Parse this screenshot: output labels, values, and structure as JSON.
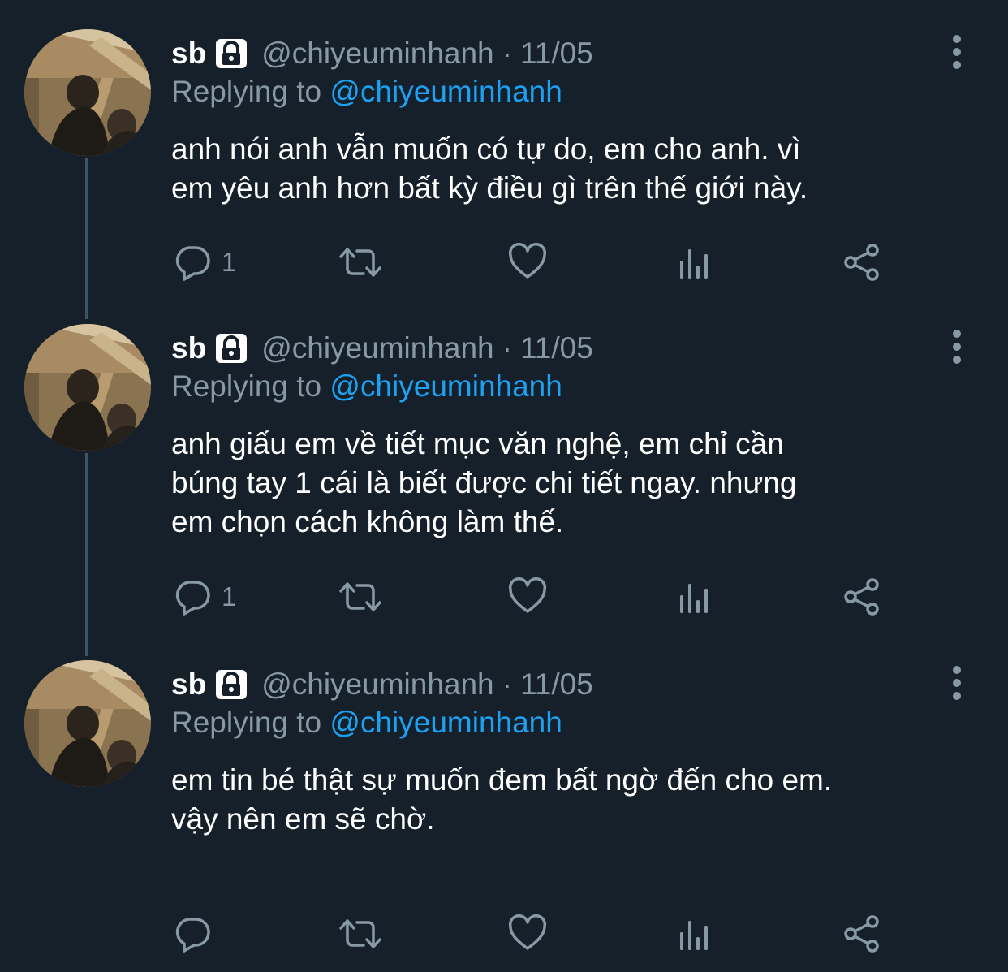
{
  "colors": {
    "background": "#15202b",
    "text_primary": "#ffffff",
    "text_secondary": "#8899a6",
    "accent": "#1da1f2",
    "thread_line": "#3d5466"
  },
  "tweets": [
    {
      "name": "sb",
      "handle": "@chiyeuminhanh",
      "separator": "·",
      "date": "11/05",
      "replying_prefix": "Replying to",
      "replying_handle": "@chiyeuminhanh",
      "lines": [
        "anh nói anh vẫn muốn có tự do, em cho anh. vì",
        "em yêu anh hơn bất kỳ điều gì trên thế giới này."
      ],
      "reply_count": "1"
    },
    {
      "name": "sb",
      "handle": "@chiyeuminhanh",
      "separator": "·",
      "date": "11/05",
      "replying_prefix": "Replying to",
      "replying_handle": "@chiyeuminhanh",
      "lines": [
        "anh giấu em về tiết mục văn nghệ, em chỉ cần",
        "búng tay 1 cái là biết được chi tiết ngay. nhưng",
        "em chọn cách không làm thế."
      ],
      "reply_count": "1"
    },
    {
      "name": "sb",
      "handle": "@chiyeuminhanh",
      "separator": "·",
      "date": "11/05",
      "replying_prefix": "Replying to",
      "replying_handle": "@chiyeuminhanh",
      "lines": [
        "em tin bé thật sự muốn đem bất ngờ đến cho em.",
        "vậy nên em sẽ chờ."
      ],
      "reply_count": ""
    }
  ],
  "icons": {
    "protected": "lock-icon",
    "more": "more-vertical-icon",
    "reply": "reply-icon",
    "retweet": "retweet-icon",
    "like": "like-icon",
    "analytics": "analytics-icon",
    "share": "share-icon"
  }
}
